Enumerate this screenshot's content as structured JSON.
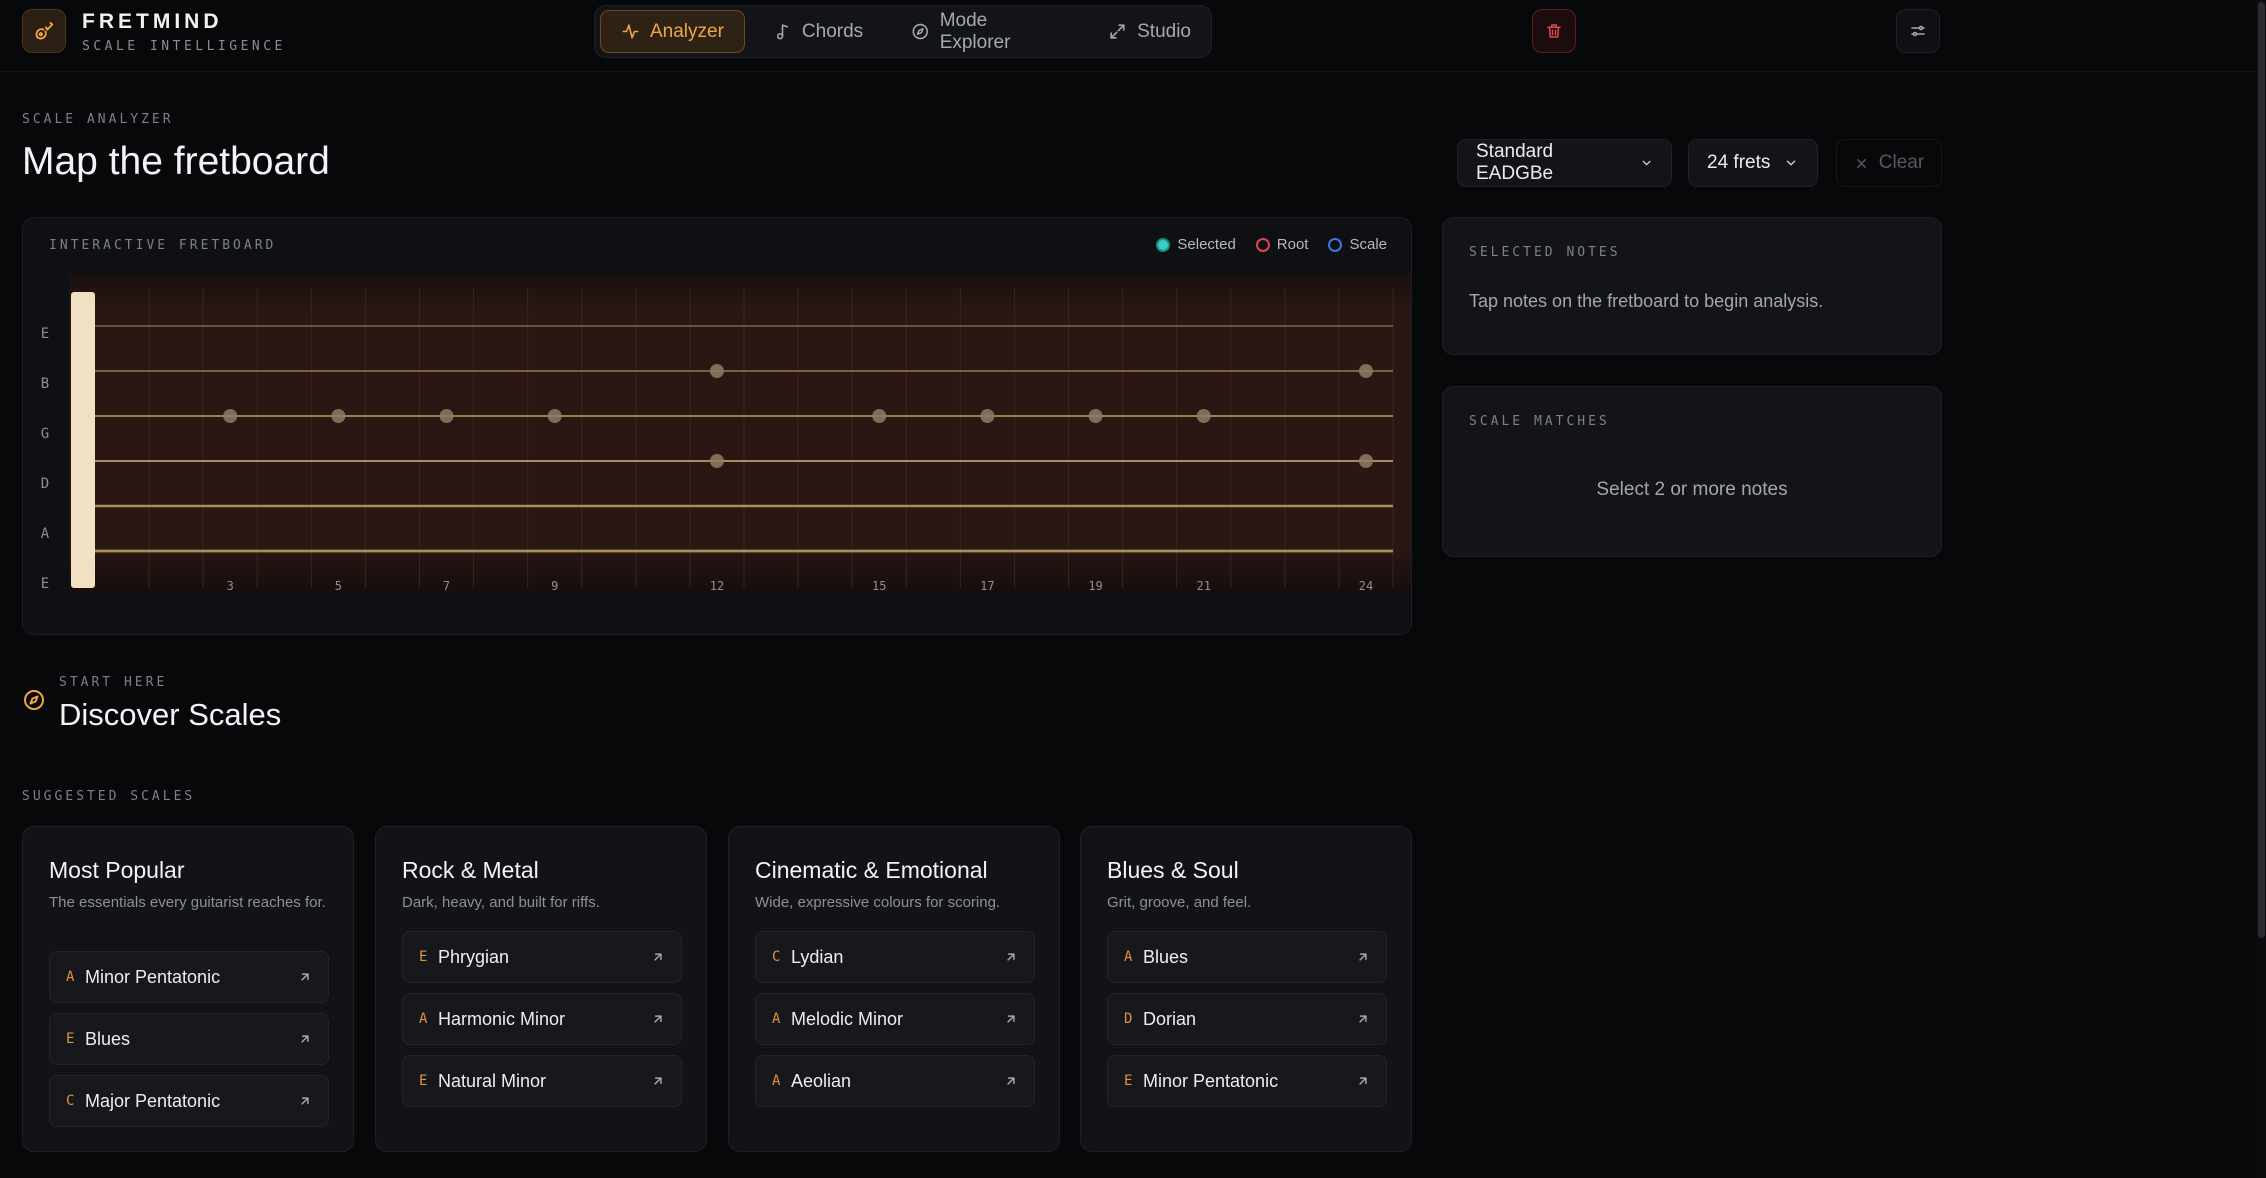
{
  "brand": {
    "name": "FRETMIND",
    "subtitle": "SCALE INTELLIGENCE"
  },
  "nav": {
    "items": [
      {
        "label": "Analyzer",
        "icon": "activity-icon",
        "active": true
      },
      {
        "label": "Chords",
        "icon": "music-note-icon",
        "active": false
      },
      {
        "label": "Mode Explorer",
        "icon": "compass-icon",
        "active": false
      },
      {
        "label": "Studio",
        "icon": "expand-icon",
        "active": false
      }
    ]
  },
  "page": {
    "eyebrow": "SCALE ANALYZER",
    "title": "Map the fretboard"
  },
  "controls": {
    "tuning": "Standard EADGBe",
    "frets": "24 frets",
    "clear": "Clear"
  },
  "fretboard": {
    "label": "INTERACTIVE FRETBOARD",
    "legend": {
      "selected": "Selected",
      "root": "Root",
      "scale": "Scale"
    },
    "strings": [
      "E",
      "B",
      "G",
      "D",
      "A",
      "E"
    ],
    "fret_count": 24,
    "inlay_frets": [
      "3",
      "5",
      "7",
      "9",
      "12",
      "15",
      "17",
      "19",
      "21",
      "24"
    ],
    "colors": {
      "wood": "#2a1714",
      "string": "#bfa26a",
      "marker": "#8f7d62"
    }
  },
  "selected_notes": {
    "title": "SELECTED NOTES",
    "hint": "Tap notes on the fretboard to begin analysis."
  },
  "scale_matches": {
    "title": "SCALE MATCHES",
    "hint": "Select 2 or more notes"
  },
  "discover": {
    "eyebrow": "START HERE",
    "title": "Discover Scales",
    "suggested_label": "SUGGESTED SCALES",
    "cards": [
      {
        "title": "Most Popular",
        "desc": "The essentials every guitarist reaches for.",
        "scales": [
          {
            "root": "A",
            "name": "Minor Pentatonic"
          },
          {
            "root": "E",
            "name": "Blues"
          },
          {
            "root": "C",
            "name": "Major Pentatonic"
          }
        ]
      },
      {
        "title": "Rock & Metal",
        "desc": "Dark, heavy, and built for riffs.",
        "scales": [
          {
            "root": "E",
            "name": "Phrygian"
          },
          {
            "root": "A",
            "name": "Harmonic Minor"
          },
          {
            "root": "E",
            "name": "Natural Minor"
          }
        ]
      },
      {
        "title": "Cinematic & Emotional",
        "desc": "Wide, expressive colours for scoring.",
        "scales": [
          {
            "root": "C",
            "name": "Lydian"
          },
          {
            "root": "A",
            "name": "Melodic Minor"
          },
          {
            "root": "A",
            "name": "Aeolian"
          }
        ]
      },
      {
        "title": "Blues & Soul",
        "desc": "Grit, groove, and feel.",
        "scales": [
          {
            "root": "A",
            "name": "Blues"
          },
          {
            "root": "D",
            "name": "Dorian"
          },
          {
            "root": "E",
            "name": "Minor Pentatonic"
          }
        ]
      }
    ]
  },
  "theme": {
    "accent": "#f0a448",
    "danger": "#e0474d",
    "teal": "#35d1c1",
    "blue": "#3d7ad9"
  }
}
